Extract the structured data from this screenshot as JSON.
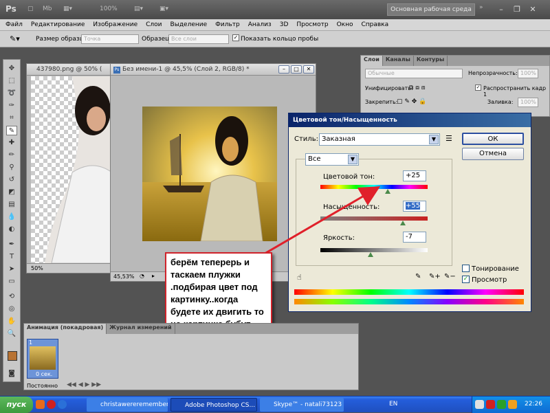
{
  "app": {
    "logo": "Ps",
    "zoom": "100%",
    "workspace": "Основная рабочая среда"
  },
  "menu": [
    "Файл",
    "Редактирование",
    "Изображение",
    "Слои",
    "Выделение",
    "Фильтр",
    "Анализ",
    "3D",
    "Просмотр",
    "Окно",
    "Справка"
  ],
  "options": {
    "sample_size_label": "Размер образца:",
    "sample_size_value": "Точка",
    "sample_label": "Образец:",
    "sample_value": "Все слои",
    "ring_label": "Показать кольцо пробы"
  },
  "doc1": {
    "title": "437980.png @ 50% (",
    "zoom": "50%"
  },
  "doc2": {
    "title": "Без имени-1 @ 45,5% (Слой 2, RGB/8) *",
    "zoom": "45,53%"
  },
  "dialog": {
    "title": "Цветовой тон/Насыщенность",
    "style_label": "Стиль:",
    "style_value": "Заказная",
    "ok": "ОК",
    "cancel": "Отмена",
    "channel": "Все",
    "hue_label": "Цветовой тон:",
    "hue_value": "+25",
    "sat_label": "Насыщенность:",
    "sat_value": "+55",
    "light_label": "Яркость:",
    "light_value": "-7",
    "colorize": "Тонирование",
    "preview": "Просмотр",
    "hue_pos": 0.63,
    "sat_pos": 0.77,
    "light_pos": 0.47
  },
  "layers": {
    "tabs": [
      "Слои",
      "Каналы",
      "Контуры"
    ],
    "blend": "Обычные",
    "opacity_label": "Непрозрачность:",
    "opacity": "100%",
    "unify": "Унифицировать:",
    "propagate": "Распространить кадр 1",
    "lock": "Закрепить:",
    "fill_label": "Заливка:",
    "fill": "100%"
  },
  "anim": {
    "tabs": [
      "Анимация (покадровая)",
      "Журнал измерений"
    ],
    "frame_num": "1",
    "frame_time": "0 сек.",
    "loop": "Постоянно"
  },
  "annotation": "берём теперерь и таскаем плужки .подбирая цвет под картинку..когда будете их двигить то на картинке бубут видны изменения",
  "taskbar": {
    "start": "пуск",
    "tasks": [
      "christawereremember -",
      "Adobe Photoshop CS...",
      "Skype™ - natali73123"
    ],
    "lang": "EN",
    "clock": "22:26"
  }
}
